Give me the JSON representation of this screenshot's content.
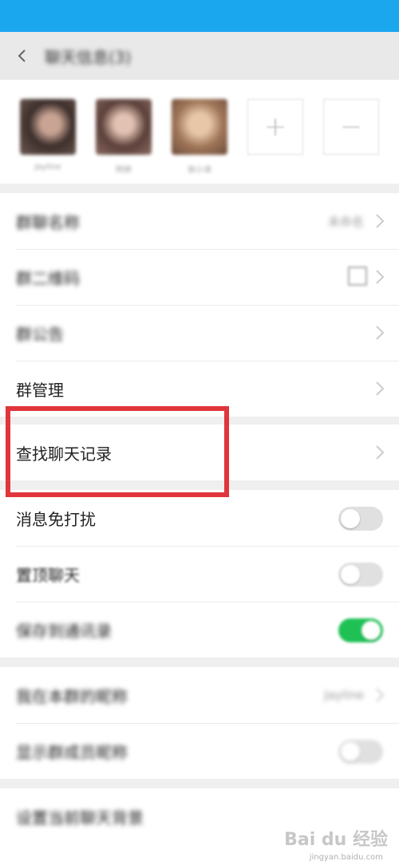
{
  "header": {
    "title": "聊天信息(3)",
    "back_icon": "chevron-left-icon"
  },
  "members": [
    {
      "name": "Jayline",
      "color": "#5c4a44"
    },
    {
      "name": "阿娇",
      "color": "#7a5a52"
    },
    {
      "name": "张小泽",
      "color": "#a0785c"
    }
  ],
  "member_actions": {
    "add": "+",
    "remove": "−"
  },
  "group_info": {
    "name_label": "群聊名称",
    "name_value": "未命名",
    "qr_label": "群二维码",
    "notice_label": "群公告",
    "manage_label": "群管理"
  },
  "search": {
    "label": "查找聊天记录"
  },
  "settings": {
    "mute_label": "消息免打扰",
    "pin_label": "置顶聊天",
    "save_label": "保存到通讯录",
    "mute_on": false,
    "pin_on": false,
    "save_on": true
  },
  "more": {
    "nickname_label": "我在本群的昵称",
    "nickname_value": "Jayline",
    "show_nick_label": "显示群成员昵称",
    "bg_label": "设置当前聊天背景"
  },
  "watermark": {
    "text": "Bai du 经验",
    "sub": "jingyan.baidu.com"
  },
  "colors": {
    "status_bar": "#1aa7ee",
    "highlight": "#e0353b",
    "toggle_on": "#1fc155"
  }
}
